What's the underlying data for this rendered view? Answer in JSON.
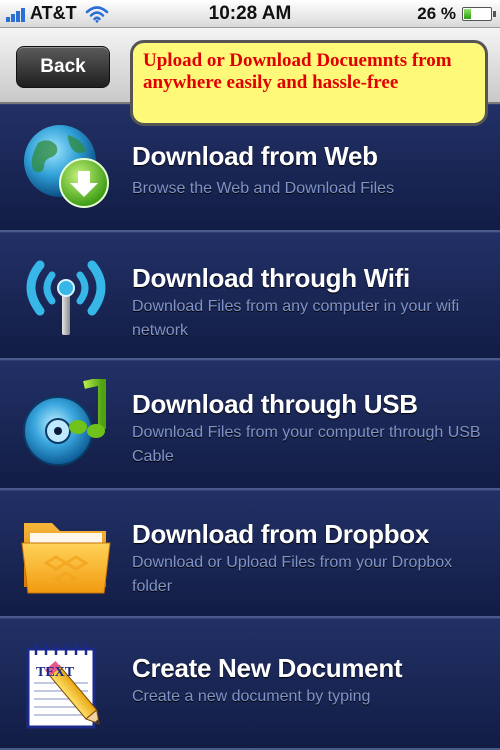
{
  "status": {
    "carrier": "AT&T",
    "time": "10:28 AM",
    "battery_text": "26 %",
    "battery_level": 0.26,
    "signal_icon": "signal-bars-icon",
    "wifi_icon": "wifi-icon"
  },
  "nav": {
    "back_label": "Back",
    "callout": "Upload or Download Docuemnts from anywhere easily and hassle-free"
  },
  "menu": [
    {
      "title": "Download from Web",
      "subtitle": "Browse the Web and Download Files",
      "icon": "globe-download-icon"
    },
    {
      "title": "Download through Wifi",
      "subtitle": "Download Files from any computer in your wifi network",
      "icon": "wifi-antenna-icon"
    },
    {
      "title": "Download through USB",
      "subtitle": "Download Files from your computer through USB Cable",
      "icon": "disc-music-icon"
    },
    {
      "title": "Download from Dropbox",
      "subtitle": "Download or Upload Files from your Dropbox folder",
      "icon": "dropbox-folder-icon"
    },
    {
      "title": "Create  New Document",
      "subtitle": "Create a new document by typing",
      "icon_label": "TEXT",
      "icon": "notepad-pencil-icon"
    }
  ],
  "colors": {
    "row_bg": "#1a2656",
    "title": "#ffffff",
    "subtitle": "#7f93c5",
    "callout_bg": "#fff97a",
    "callout_text": "#e00000"
  }
}
